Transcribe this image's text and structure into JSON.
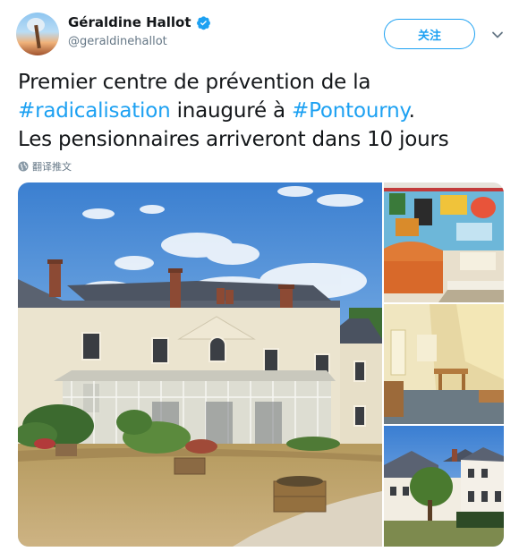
{
  "author": {
    "display_name": "Géraldine Hallot",
    "handle": "@geraldinehallot",
    "avatar_icon": "avatar-photo",
    "verified_icon": "verified-badge-icon"
  },
  "actions": {
    "follow_label": "关注",
    "more_icon": "chevron-down-icon"
  },
  "tweet": {
    "line1": "Premier centre de prévention de la",
    "hashtag1": "#radicalisation",
    "mid": " inauguré à ",
    "hashtag2": "#Pontourny",
    "end1": ".",
    "line3": "Les pensionnaires arriveront dans 10 jours"
  },
  "translate": {
    "label": "翻译推文",
    "icon": "globe-icon"
  },
  "media": {
    "count": 4,
    "photos": [
      "manor-house-photo",
      "painted-room-photo",
      "bedroom-photo",
      "building-exterior-photo"
    ]
  },
  "colors": {
    "accent": "#1da1f2",
    "text": "#14171a",
    "secondary": "#657786"
  }
}
